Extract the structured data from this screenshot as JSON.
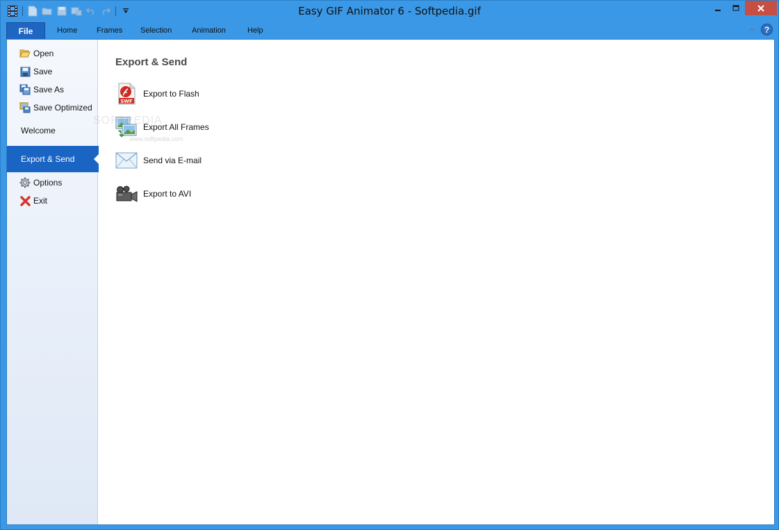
{
  "window": {
    "title": "Easy GIF Animator 6 - Softpedia.gif"
  },
  "quick_access": {
    "icons": [
      "app-icon",
      "new-icon",
      "open-icon",
      "save-icon",
      "save-optimized-icon",
      "undo-icon",
      "redo-icon",
      "customize-qat-icon"
    ]
  },
  "ribbon": {
    "file_label": "File",
    "tabs": [
      "Home",
      "Frames",
      "Selection",
      "Animation",
      "Help"
    ],
    "help_label": "?"
  },
  "sidebar": {
    "items": [
      {
        "label": "Open",
        "icon": "folder-open-icon"
      },
      {
        "label": "Save",
        "icon": "floppy-icon"
      },
      {
        "label": "Save As",
        "icon": "save-as-icon"
      },
      {
        "label": "Save Optimized",
        "icon": "save-optimized-icon"
      },
      {
        "label": "Welcome"
      },
      {
        "label": "Export & Send"
      },
      {
        "label": "Options",
        "icon": "gear-icon"
      },
      {
        "label": "Exit",
        "icon": "red-x-icon"
      }
    ],
    "active": "Export & Send"
  },
  "main": {
    "title": "Export & Send",
    "actions": [
      {
        "label": "Export to Flash",
        "icon": "swf-file-icon"
      },
      {
        "label": "Export All Frames",
        "icon": "frames-icon"
      },
      {
        "label": "Send via E-mail",
        "icon": "envelope-icon"
      },
      {
        "label": "Export to AVI",
        "icon": "video-camera-icon"
      }
    ]
  },
  "watermark": {
    "text": "SOFTPEDIA",
    "sub": "www.softpedia.com"
  },
  "colors": {
    "title_bar": "#3a98e6",
    "file_tab": "#1f65c2",
    "sidebar_active": "#1a64c4",
    "close_button": "#c74e43"
  }
}
